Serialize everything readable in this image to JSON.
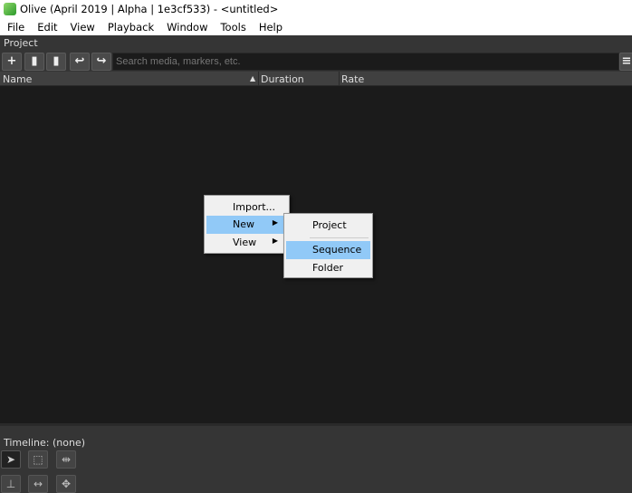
{
  "window": {
    "title": "Olive (April 2019 | Alpha | 1e3cf533) - <untitled>"
  },
  "menubar": [
    "File",
    "Edit",
    "View",
    "Playback",
    "Window",
    "Tools",
    "Help"
  ],
  "project": {
    "title": "Project",
    "search_placeholder": "Search media, markers, etc.",
    "columns": [
      "Name",
      "Duration",
      "Rate"
    ]
  },
  "context_menu": {
    "items": [
      "Import...",
      "New",
      "View"
    ],
    "submenu": [
      "Project",
      "Sequence",
      "Folder"
    ]
  },
  "timeline": {
    "label": "Timeline: (none)"
  },
  "colors": {
    "highlight": "#91c9f7",
    "panel": "#353535",
    "list": "#1b1b1b"
  }
}
